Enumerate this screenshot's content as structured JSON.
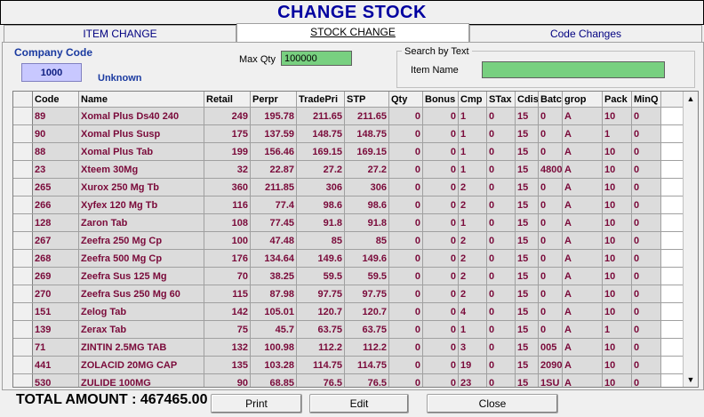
{
  "window": {
    "title": "CHANGE STOCK"
  },
  "tabs": [
    {
      "label": "ITEM CHANGE",
      "active": false
    },
    {
      "label": "STOCK CHANGE",
      "active": true
    },
    {
      "label": "Code Changes",
      "active": false
    }
  ],
  "company": {
    "label": "Company Code",
    "code": "1000",
    "name": "Unknown"
  },
  "max_qty": {
    "label": "Max Qty",
    "value": "100000"
  },
  "search": {
    "group_label": "Search by Text",
    "item_label": "Item Name",
    "item_value": ""
  },
  "table": {
    "columns": [
      "Code",
      "Name",
      "Retail",
      "Perpr",
      "TradePri",
      "STP",
      "Qty",
      "Bonus",
      "Cmp",
      "STax",
      "Cdis",
      "Batc",
      "grop",
      "Pack",
      "MinQ"
    ],
    "rows": [
      [
        "89",
        "Xomal Plus Ds40 240",
        "249",
        "195.78",
        "211.65",
        "211.65",
        "0",
        "0",
        "1",
        "0",
        "15",
        "0",
        "A",
        "10",
        "0"
      ],
      [
        "90",
        "Xomal Plus Susp",
        "175",
        "137.59",
        "148.75",
        "148.75",
        "0",
        "0",
        "1",
        "0",
        "15",
        "0",
        "A",
        "1",
        "0"
      ],
      [
        "88",
        "Xomal Plus Tab",
        "199",
        "156.46",
        "169.15",
        "169.15",
        "0",
        "0",
        "1",
        "0",
        "15",
        "0",
        "A",
        "10",
        "0"
      ],
      [
        "23",
        "Xteem 30Mg",
        "32",
        "22.87",
        "27.2",
        "27.2",
        "0",
        "0",
        "1",
        "0",
        "15",
        "4800",
        "A",
        "10",
        "0"
      ],
      [
        "265",
        "Xurox 250 Mg Tb",
        "360",
        "211.85",
        "306",
        "306",
        "0",
        "0",
        "2",
        "0",
        "15",
        "0",
        "A",
        "10",
        "0"
      ],
      [
        "266",
        "Xyfex 120 Mg Tb",
        "116",
        "77.4",
        "98.6",
        "98.6",
        "0",
        "0",
        "2",
        "0",
        "15",
        "0",
        "A",
        "10",
        "0"
      ],
      [
        "128",
        "Zaron Tab",
        "108",
        "77.45",
        "91.8",
        "91.8",
        "0",
        "0",
        "1",
        "0",
        "15",
        "0",
        "A",
        "10",
        "0"
      ],
      [
        "267",
        "Zeefra 250 Mg Cp",
        "100",
        "47.48",
        "85",
        "85",
        "0",
        "0",
        "2",
        "0",
        "15",
        "0",
        "A",
        "10",
        "0"
      ],
      [
        "268",
        "Zeefra 500 Mg Cp",
        "176",
        "134.64",
        "149.6",
        "149.6",
        "0",
        "0",
        "2",
        "0",
        "15",
        "0",
        "A",
        "10",
        "0"
      ],
      [
        "269",
        "Zeefra Sus 125 Mg",
        "70",
        "38.25",
        "59.5",
        "59.5",
        "0",
        "0",
        "2",
        "0",
        "15",
        "0",
        "A",
        "10",
        "0"
      ],
      [
        "270",
        "Zeefra Sus 250 Mg 60",
        "115",
        "87.98",
        "97.75",
        "97.75",
        "0",
        "0",
        "2",
        "0",
        "15",
        "0",
        "A",
        "10",
        "0"
      ],
      [
        "151",
        "Zelog Tab",
        "142",
        "105.01",
        "120.7",
        "120.7",
        "0",
        "0",
        "4",
        "0",
        "15",
        "0",
        "A",
        "10",
        "0"
      ],
      [
        "139",
        "Zerax Tab",
        "75",
        "45.7",
        "63.75",
        "63.75",
        "0",
        "0",
        "1",
        "0",
        "15",
        "0",
        "A",
        "1",
        "0"
      ],
      [
        "71",
        "ZINTIN 2.5MG TAB",
        "132",
        "100.98",
        "112.2",
        "112.2",
        "0",
        "0",
        "3",
        "0",
        "15",
        "005",
        "A",
        "10",
        "0"
      ],
      [
        "441",
        "ZOLACID 20MG CAP",
        "135",
        "103.28",
        "114.75",
        "114.75",
        "0",
        "0",
        "19",
        "0",
        "15",
        "2090",
        "A",
        "10",
        "0"
      ],
      [
        "530",
        "ZULIDE 100MG",
        "90",
        "68.85",
        "76.5",
        "76.5",
        "0",
        "0",
        "23",
        "0",
        "15",
        "1SU",
        "A",
        "10",
        "0"
      ]
    ]
  },
  "total": {
    "text": "TOTAL AMOUNT :  467465.00"
  },
  "buttons": {
    "print": "Print",
    "edit": "Edit",
    "close": "Close"
  },
  "icons": {
    "scroll_up": "scroll-up-arrow-icon",
    "scroll_down": "scroll-down-arrow-icon"
  }
}
